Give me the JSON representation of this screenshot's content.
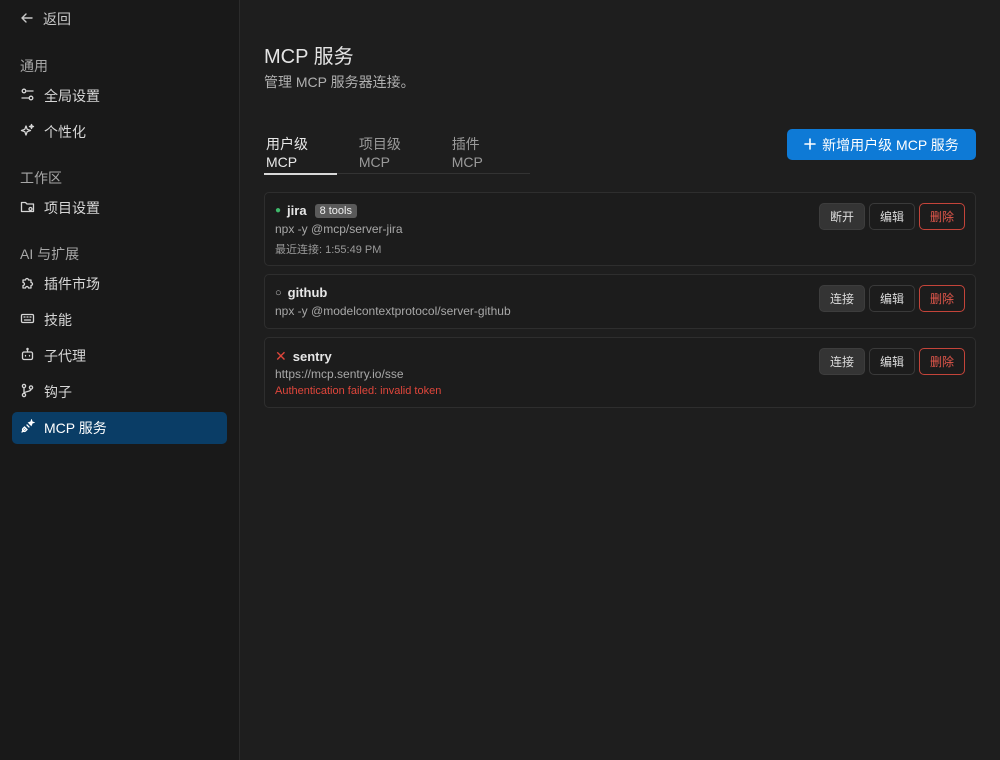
{
  "sidebar": {
    "back_label": "返回",
    "sections": {
      "general": "通用",
      "workspace": "工作区",
      "ai": "AI 与扩展"
    },
    "items": [
      {
        "label": "全局设置",
        "icon": "sliders-icon"
      },
      {
        "label": "个性化",
        "icon": "sparkle-icon"
      },
      {
        "label": "项目设置",
        "icon": "folder-gear-icon"
      },
      {
        "label": "插件市场",
        "icon": "puzzle-icon"
      },
      {
        "label": "技能",
        "icon": "keyboard-icon"
      },
      {
        "label": "子代理",
        "icon": "robot-icon"
      },
      {
        "label": "钩子",
        "icon": "git-branch-icon"
      },
      {
        "label": "MCP 服务",
        "icon": "plug-icon",
        "active": true
      }
    ]
  },
  "main": {
    "title": "MCP 服务",
    "subtitle": "管理 MCP 服务器连接。",
    "tabs": [
      {
        "label": "用户级 MCP",
        "active": true
      },
      {
        "label": "项目级 MCP"
      },
      {
        "label": "插件 MCP"
      }
    ],
    "add_button_label": "新增用户级 MCP 服务",
    "servers": [
      {
        "name": "jira",
        "status": "connected",
        "badge": "8 tools",
        "command": "npx -y @mcp/server-jira",
        "meta": "最近连接: 1:55:49 PM",
        "actions": [
          "断开",
          "编辑",
          "删除"
        ]
      },
      {
        "name": "github",
        "status": "disconnected",
        "command": "npx -y @modelcontextprotocol/server-github",
        "actions": [
          "连接",
          "编辑",
          "删除"
        ]
      },
      {
        "name": "sentry",
        "status": "error",
        "command": "https://mcp.sentry.io/sse",
        "error": "Authentication failed: invalid token",
        "actions": [
          "连接",
          "编辑",
          "删除"
        ]
      }
    ],
    "status_glyphs": {
      "connected": "●",
      "disconnected": "○",
      "error": "✕"
    }
  },
  "colors": {
    "accent": "#0e7ad6",
    "active_nav": "#0a3d66",
    "connected": "#3fb96b",
    "error": "#e0463b"
  }
}
